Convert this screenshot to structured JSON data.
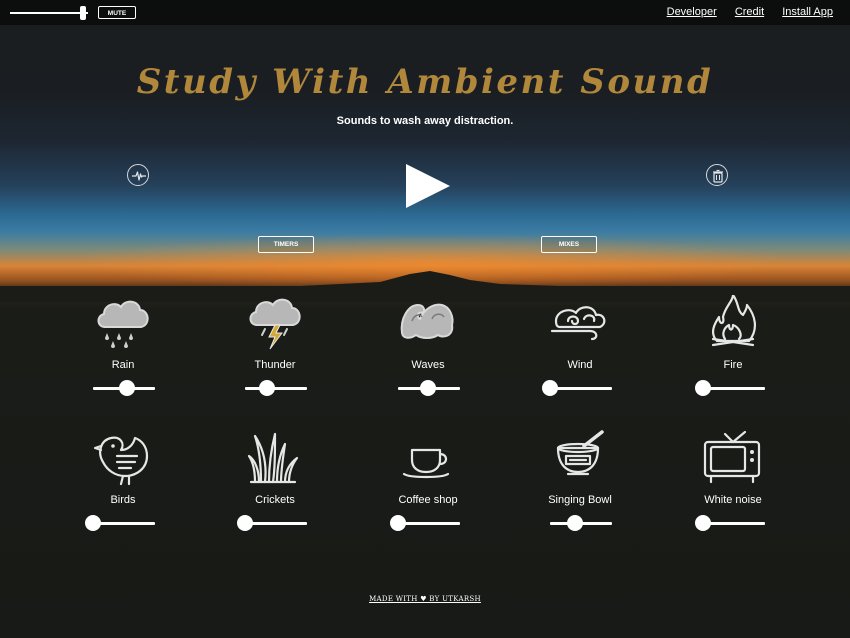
{
  "top_bar": {
    "master_volume": 0.92,
    "mute_label": "MUTE",
    "links": [
      "Developer",
      "Credit",
      "Install App"
    ]
  },
  "hero": {
    "title": "Study With Ambient Sound",
    "subtitle": "Sounds to wash away distraction.",
    "timers_label": "TIMERS",
    "mixes_label": "MIXES"
  },
  "sounds": [
    {
      "label": "Rain",
      "icon": "rain-cloud-icon",
      "volume": 0.55
    },
    {
      "label": "Thunder",
      "icon": "thunder-cloud-icon",
      "volume": 0.35
    },
    {
      "label": "Waves",
      "icon": "waves-icon",
      "volume": 0.48
    },
    {
      "label": "Wind",
      "icon": "wind-icon",
      "volume": 0.0
    },
    {
      "label": "Fire",
      "icon": "fire-icon",
      "volume": 0.0
    },
    {
      "label": "Birds",
      "icon": "bird-icon",
      "volume": 0.0
    },
    {
      "label": "Crickets",
      "icon": "grass-icon",
      "volume": 0.0
    },
    {
      "label": "Coffee shop",
      "icon": "coffee-cup-icon",
      "volume": 0.0
    },
    {
      "label": "Singing Bowl",
      "icon": "singing-bowl-icon",
      "volume": 0.4
    },
    {
      "label": "White noise",
      "icon": "tv-icon",
      "volume": 0.0
    }
  ],
  "footer": {
    "text": "MADE WITH ♥ BY UTKARSH"
  }
}
